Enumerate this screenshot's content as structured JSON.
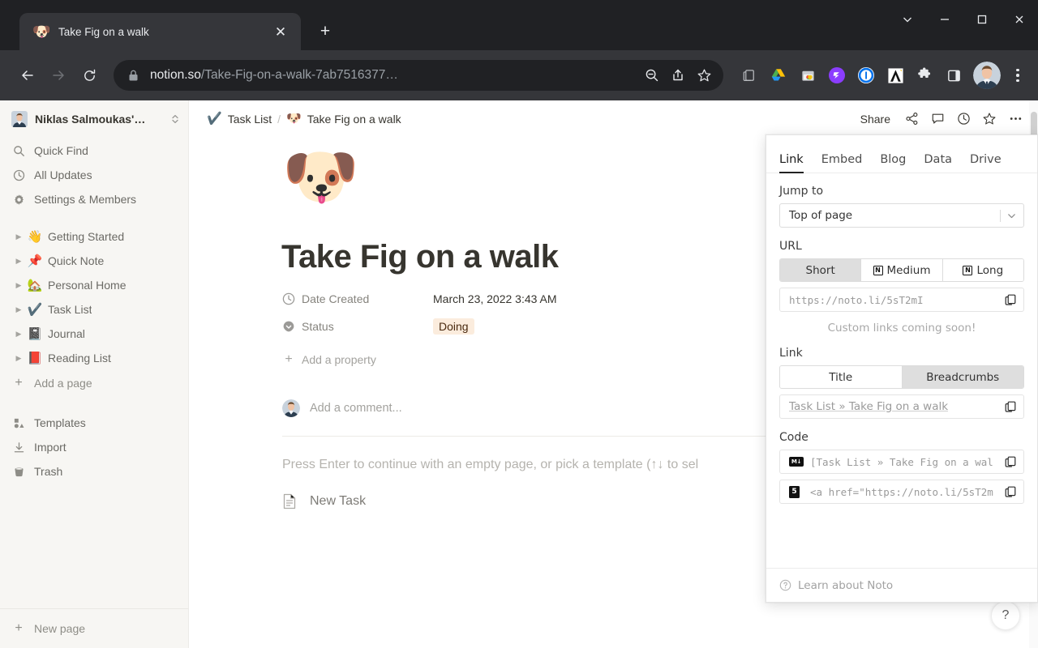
{
  "browser": {
    "tab": {
      "title": "Take Fig on a walk",
      "favicon": "🐶",
      "close_label": "✕"
    },
    "newtab_label": "+",
    "window_controls": [
      {
        "name": "tab-search-chevron",
        "label": "⌄"
      },
      {
        "name": "minimize",
        "label": "—"
      },
      {
        "name": "maximize",
        "label": "□"
      },
      {
        "name": "close",
        "label": "✕"
      }
    ],
    "nav": {
      "back": "←",
      "forward": "→",
      "reload": "⟳"
    },
    "omnibox": {
      "domain": "notion.so",
      "path": "/Take-Fig-on-a-walk-7ab7516377…",
      "lock_icon": "lock-icon"
    },
    "omnibox_actions": [
      "zoom-out-icon",
      "share-icon",
      "bookmark-star-icon"
    ],
    "extensions": [
      {
        "name": "reading-list-icon",
        "label": ""
      },
      {
        "name": "google-drive-icon",
        "label": ""
      },
      {
        "name": "screenshot-icon",
        "label": ""
      },
      {
        "name": "noto-extension-icon",
        "label": "3"
      },
      {
        "name": "1password-icon",
        "label": "1"
      },
      {
        "name": "arc-icon",
        "label": "A"
      },
      {
        "name": "extensions-puzzle-icon",
        "label": ""
      },
      {
        "name": "side-panel-icon",
        "label": ""
      }
    ],
    "profile_avatar": "profile-avatar",
    "menu": "⋮"
  },
  "sidebar": {
    "workspace": {
      "name": "Niklas Salmoukas'…",
      "avatar": "user-avatar"
    },
    "nav_items": [
      {
        "icon": "search-icon",
        "label": "Quick Find"
      },
      {
        "icon": "clock-icon",
        "label": "All Updates"
      },
      {
        "icon": "gear-icon",
        "label": "Settings & Members"
      }
    ],
    "pages": [
      {
        "emoji": "👋",
        "label": "Getting Started"
      },
      {
        "emoji": "📌",
        "label": "Quick Note"
      },
      {
        "emoji": "🏡",
        "label": "Personal Home"
      },
      {
        "emoji": "✔️",
        "label": "Task List"
      },
      {
        "emoji": "📓",
        "label": "Journal"
      },
      {
        "emoji": "📕",
        "label": "Reading List"
      }
    ],
    "add_page": "Add a page",
    "bottom_items": [
      {
        "icon": "templates-icon",
        "label": "Templates"
      },
      {
        "icon": "import-icon",
        "label": "Import"
      },
      {
        "icon": "trash-icon",
        "label": "Trash"
      }
    ],
    "new_page": "New page"
  },
  "topbar": {
    "breadcrumbs": [
      {
        "emoji": "✔️",
        "label": "Task List"
      },
      {
        "emoji": "🐶",
        "label": "Take Fig on a walk"
      }
    ],
    "separator": "/",
    "share_label": "Share",
    "actions": [
      {
        "name": "share-network-icon"
      },
      {
        "name": "comment-icon"
      },
      {
        "name": "updates-clock-icon"
      },
      {
        "name": "favorite-star-icon"
      },
      {
        "name": "more-options-icon"
      }
    ]
  },
  "document": {
    "page_emoji": "🐶",
    "title": "Take Fig on a walk",
    "properties": [
      {
        "icon": "clock-icon",
        "name": "Date Created",
        "value": "March 23, 2022 3:43 AM",
        "type": "text"
      },
      {
        "icon": "select-icon",
        "name": "Status",
        "value": "Doing",
        "type": "tag"
      }
    ],
    "add_property": "Add a property",
    "comment_placeholder": "Add a comment...",
    "template_hint": "Press Enter to continue with an empty page, or pick a template (↑↓ to sel",
    "template_items": [
      {
        "icon": "page-icon",
        "label": "New Task"
      }
    ],
    "status_color": "#fbecdd",
    "status_text_color": "#49290f"
  },
  "noto_panel": {
    "tabs": [
      {
        "label": "Link",
        "active": true
      },
      {
        "label": "Embed",
        "active": false
      },
      {
        "label": "Blog",
        "active": false
      },
      {
        "label": "Data",
        "active": false
      },
      {
        "label": "Drive",
        "active": false
      }
    ],
    "jump_to": {
      "label": "Jump to",
      "value": "Top of page"
    },
    "url": {
      "label": "URL",
      "options": [
        {
          "label": "Short",
          "active": true,
          "badge": false
        },
        {
          "label": "Medium",
          "active": false,
          "badge": true
        },
        {
          "label": "Long",
          "active": false,
          "badge": true
        }
      ],
      "value": "https://noto.li/5sT2mI",
      "note": "Custom links coming soon!"
    },
    "link": {
      "label": "Link",
      "options": [
        {
          "label": "Title",
          "active": false
        },
        {
          "label": "Breadcrumbs",
          "active": true
        }
      ],
      "value": "Task List » Take Fig on a walk"
    },
    "code": {
      "label": "Code",
      "items": [
        {
          "badge": "markdown-icon",
          "badge_label": "M↓",
          "value": "[Task List » Take Fig on a wal"
        },
        {
          "badge": "html5-icon",
          "badge_label": "5",
          "value": "<a href=\"https://noto.li/5sT2m"
        }
      ]
    },
    "footer": {
      "label": "Learn about Noto",
      "icon": "question-circle-icon"
    },
    "notion_badge_letter": "N"
  },
  "help_fab": "?"
}
